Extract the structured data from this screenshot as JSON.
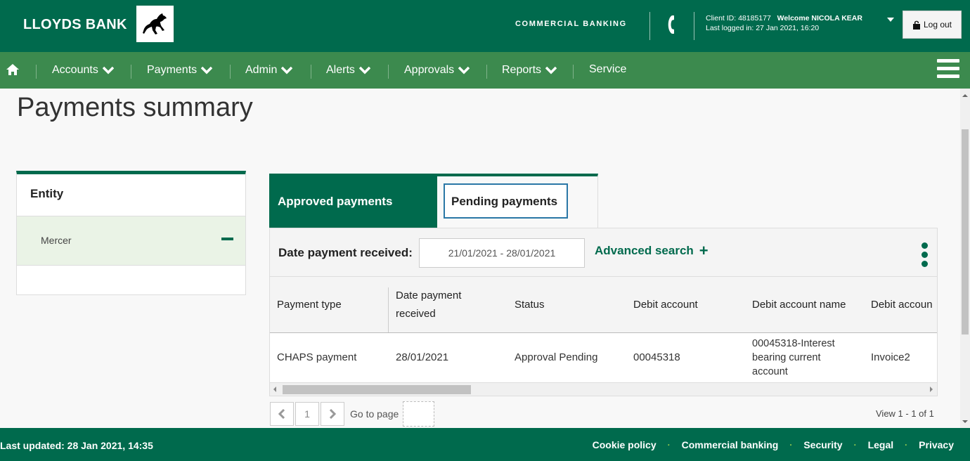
{
  "header": {
    "brand": "LLOYDS BANK",
    "section": "COMMERCIAL BANKING",
    "client_id": "Client ID: 48185177",
    "welcome": "Welcome NICOLA KEAR",
    "last_logged": "Last logged in: 27 Jan 2021, 16:20",
    "logout_label": "Log out",
    "brand_color": "#006a4d"
  },
  "nav": {
    "items": [
      {
        "label": "Accounts"
      },
      {
        "label": "Payments"
      },
      {
        "label": "Admin"
      },
      {
        "label": "Alerts"
      },
      {
        "label": "Approvals"
      },
      {
        "label": "Reports"
      },
      {
        "label": "Service"
      }
    ],
    "bar_color": "#3c8a4e"
  },
  "page": {
    "title": "Payments summary"
  },
  "entity": {
    "heading": "Entity",
    "items": [
      {
        "label": "Mercer"
      }
    ]
  },
  "tabs": [
    {
      "label": "Approved payments",
      "active": true
    },
    {
      "label": "Pending payments",
      "active": false
    }
  ],
  "filter": {
    "label": "Date payment received:",
    "date_range": "21/01/2021 - 28/01/2021",
    "advanced_search": "Advanced search",
    "plus_icon": "+"
  },
  "table": {
    "columns": [
      "Payment type",
      "Date payment received",
      "Status",
      "Debit account",
      "Debit account name",
      "Debit accoun"
    ],
    "rows": [
      {
        "payment_type": "CHAPS payment",
        "date": "28/01/2021",
        "status": "Approval Pending",
        "debit_account": "00045318",
        "debit_account_name": "00045318-Interest bearing current account",
        "reference": "Invoice2"
      }
    ]
  },
  "pagination": {
    "current_page": "1",
    "goto_label": "Go to page",
    "view_count": "View 1 - 1 of 1"
  },
  "footer": {
    "last_updated": "Last updated: 28 Jan 2021, 14:35",
    "links": [
      "Cookie policy",
      "Commercial banking",
      "Security",
      "Legal",
      "Privacy"
    ]
  }
}
